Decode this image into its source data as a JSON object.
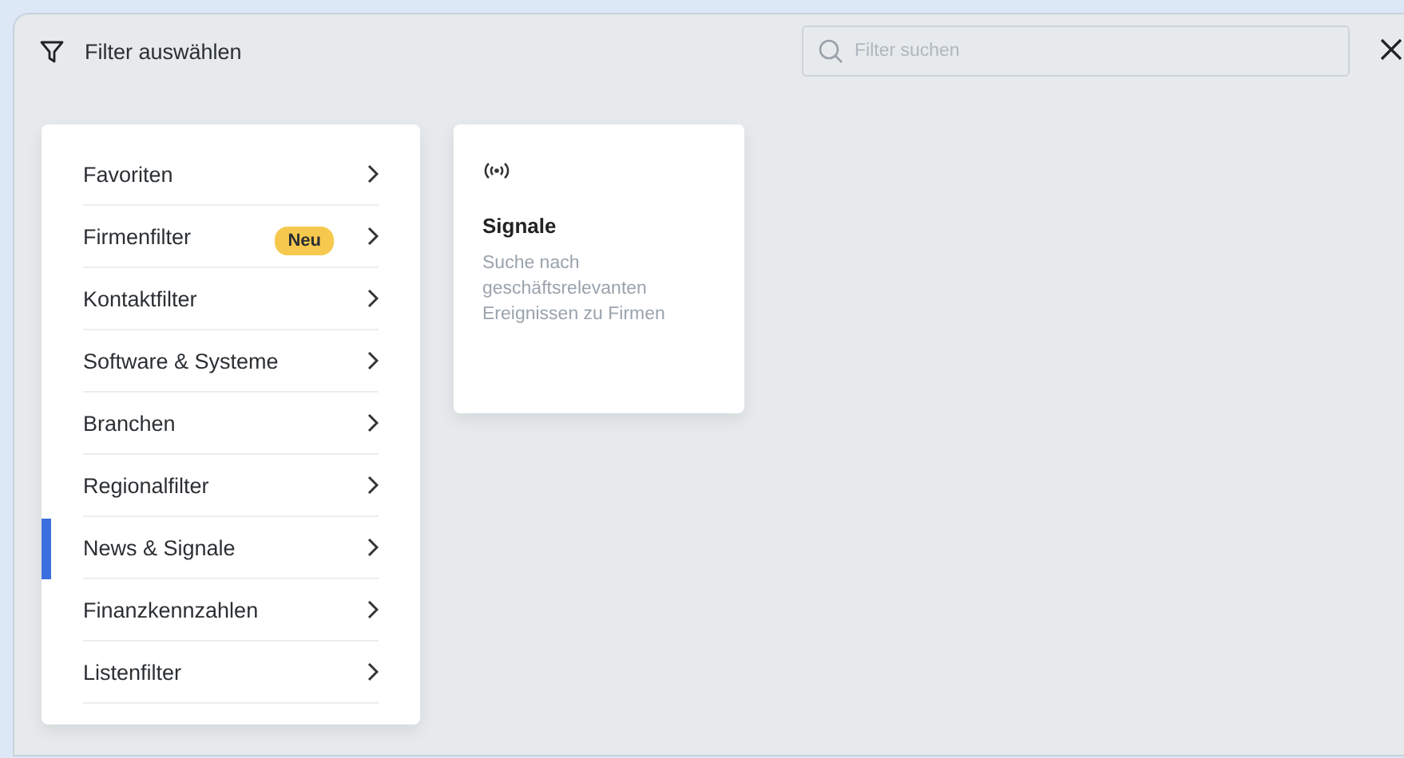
{
  "dialog": {
    "title": "Filter auswählen",
    "search": {
      "placeholder": "Filter suchen"
    }
  },
  "categories": [
    {
      "label": "Favoriten",
      "selected": false
    },
    {
      "label": "Firmenfilter",
      "selected": false,
      "badge": "Neu"
    },
    {
      "label": "Kontaktfilter",
      "selected": false
    },
    {
      "label": "Software & Systeme",
      "selected": false
    },
    {
      "label": "Branchen",
      "selected": false
    },
    {
      "label": "Regionalfilter",
      "selected": false
    },
    {
      "label": "News & Signale",
      "selected": true
    },
    {
      "label": "Finanzkennzahlen",
      "selected": false
    },
    {
      "label": "Listenfilter",
      "selected": false
    }
  ],
  "cards": [
    {
      "title": "Signale",
      "description": "Suche nach geschäftsrelevanten Ereignissen zu Firmen"
    }
  ]
}
